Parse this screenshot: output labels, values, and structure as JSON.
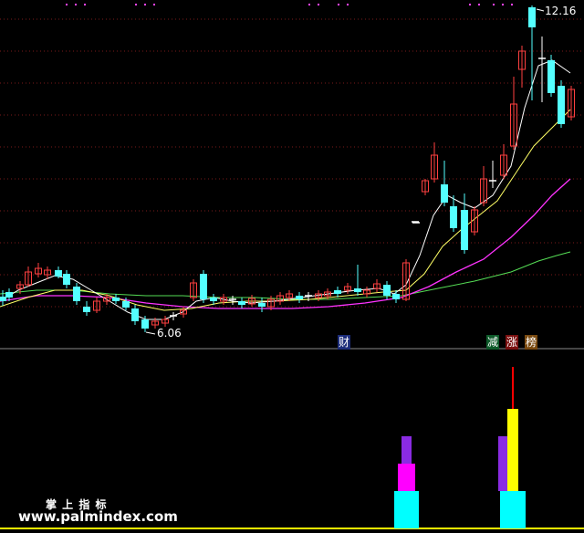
{
  "labels": {
    "high_price": "12.16",
    "low_price": "6.06"
  },
  "tags": [
    {
      "id": "cai",
      "text": "财",
      "bg": "#1c2c7a",
      "color": "#ffffff"
    },
    {
      "id": "jian",
      "text": "减",
      "bg": "#0e5a2a",
      "color": "#ffffff"
    },
    {
      "id": "zhang",
      "text": "涨",
      "bg": "#7a1010",
      "color": "#ffffff"
    },
    {
      "id": "bang",
      "text": "榜",
      "bg": "#7a4a10",
      "color": "#ffffff"
    }
  ],
  "footer": {
    "title": "掌 上 指 标",
    "url": "www.palmindex.com"
  },
  "colors": {
    "background": "#000000",
    "grid": "#7a1a1a",
    "up_candle": "#ff4040",
    "down_candle": "#54ffff",
    "ma_fast": "#ffffff",
    "ma_mid": "#ffff66",
    "ma_slow": "#ff33ff",
    "ma_long": "#55dd55",
    "divider": "#888888",
    "bar_cyan": "#00ffff",
    "bar_magenta": "#ff00ff",
    "bar_purple": "#8a2be2",
    "bar_yellow": "#ffff00",
    "bar_red": "#ff0000",
    "top_dots": "#ff44ff"
  },
  "chart_data": {
    "type": "candlestick",
    "y_high_mark": 12.16,
    "y_low_mark": 6.06,
    "grid": true
  }
}
